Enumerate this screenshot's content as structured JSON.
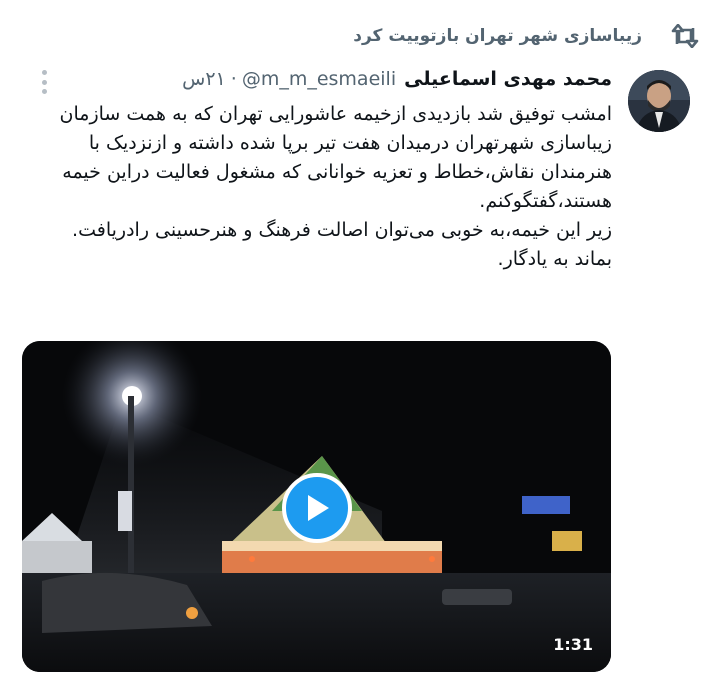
{
  "retweet": {
    "text": "زیباسازی شهر تهران بازتوییت کرد",
    "icon": "retweet-icon"
  },
  "tweet": {
    "author_name": "محمد مهدی اسماعیلی",
    "handle": "@m_m_esmaeili",
    "separator": "·",
    "time": "۲۱س",
    "more_icon": "more-options-icon",
    "paragraphs": [
      "امشب توفیق شد بازدیدی ازخیمه عاشورایی تهران که به همت سازمان زیباسازی شهرتهران درمیدان هفت تیر برپا شده داشته و ازنزدیک با هنرمندان نقاش،خطاط و تعزیه خوانانی که مشغول فعالیت دراین خیمه هستند،گفتگوکنم.",
      "زیر این خیمه،به خوبی می‌توان اصالت فرهنگ و هنرحسینی رادریافت.",
      "بماند به یادگار."
    ]
  },
  "media": {
    "type": "video",
    "duration": "1:31",
    "play_icon": "play-icon"
  },
  "colors": {
    "accent": "#1d9bf0",
    "secondary_text": "#536471",
    "primary_text": "#0f1419"
  }
}
